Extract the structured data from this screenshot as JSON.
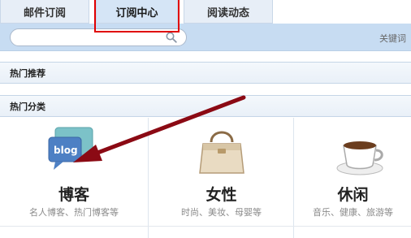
{
  "tabs": [
    {
      "label": "邮件订阅",
      "active": false
    },
    {
      "label": "订阅中心",
      "active": true
    },
    {
      "label": "阅读动态",
      "active": false
    }
  ],
  "search": {
    "value": "",
    "placeholder": "",
    "hint_label": "关键词"
  },
  "sections": {
    "hot_recommend": "热门推荐",
    "hot_categories": "热门分类"
  },
  "categories": [
    {
      "title": "博客",
      "desc": "名人博客、热门博客等",
      "icon": "blog-icon",
      "icon_text": "blog"
    },
    {
      "title": "女性",
      "desc": "时尚、美妆、母婴等",
      "icon": "handbag-icon"
    },
    {
      "title": "休闲",
      "desc": "音乐、健康、旅游等",
      "icon": "coffee-cup-icon"
    }
  ],
  "colors": {
    "tab_bg": "#e7eef7",
    "search_band": "#c7dcf2",
    "highlight_box": "#e00000",
    "arrow": "#8b0a14"
  }
}
